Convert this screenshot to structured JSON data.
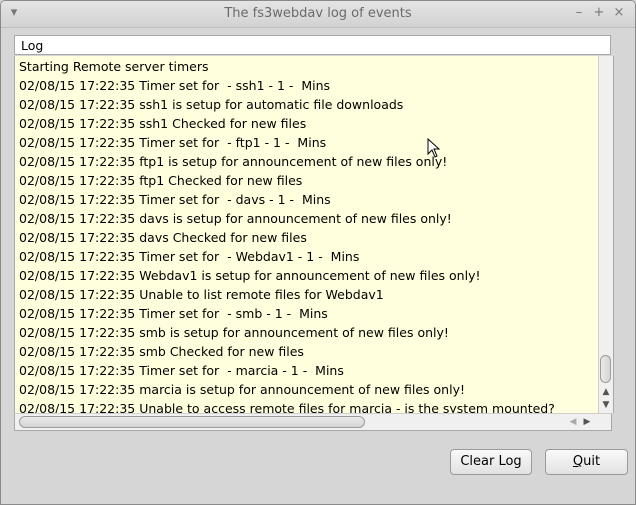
{
  "window": {
    "title": "The fs3webdav log of events",
    "menu_icon": "chevron-down-icon",
    "min_icon": "minimize-icon",
    "max_icon": "maximize-icon",
    "close_icon": "close-icon"
  },
  "log": {
    "header": "Log",
    "lines": [
      "Starting Remote server timers",
      "02/08/15 17:22:35 Timer set for  - ssh1 - 1 -  Mins",
      "02/08/15 17:22:35 ssh1 is setup for automatic file downloads",
      "02/08/15 17:22:35 ssh1 Checked for new files",
      "02/08/15 17:22:35 Timer set for  - ftp1 - 1 -  Mins",
      "02/08/15 17:22:35 ftp1 is setup for announcement of new files only!",
      "02/08/15 17:22:35 ftp1 Checked for new files",
      "02/08/15 17:22:35 Timer set for  - davs - 1 -  Mins",
      "02/08/15 17:22:35 davs is setup for announcement of new files only!",
      "02/08/15 17:22:35 davs Checked for new files",
      "02/08/15 17:22:35 Timer set for  - Webdav1 - 1 -  Mins",
      "02/08/15 17:22:35 Webdav1 is setup for announcement of new files only!",
      "02/08/15 17:22:35 Unable to list remote files for Webdav1",
      "02/08/15 17:22:35 Timer set for  - smb - 1 -  Mins",
      "02/08/15 17:22:35 smb is setup for announcement of new files only!",
      "02/08/15 17:22:35 smb Checked for new files",
      "02/08/15 17:22:35 Timer set for  - marcia - 1 -  Mins",
      "02/08/15 17:22:35 marcia is setup for announcement of new files only!",
      "02/08/15 17:22:35 Unable to access remote files for marcia - is the system mounted?"
    ],
    "background_color": "#ffffdd"
  },
  "buttons": {
    "clear_log": "Clear Log",
    "quit_first": "Q",
    "quit_rest": "uit"
  }
}
